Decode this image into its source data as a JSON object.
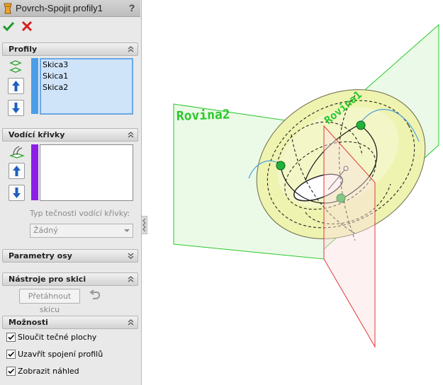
{
  "window": {
    "title": "Povrch-Spojit profily1",
    "help_label": "?"
  },
  "icons": {
    "title": "loft-feature-icon",
    "ok": "check-icon",
    "cancel": "x-icon",
    "help": "help-icon"
  },
  "sections": {
    "profiles": {
      "label": "Profily",
      "items": [
        "Skica3",
        "Skica1",
        "Skica2"
      ]
    },
    "guide_curves": {
      "label": "Vodící křivky",
      "items": [],
      "tangency_label": "Typ tečnosti vodící křivky:",
      "tangency_value": "Žádný"
    },
    "centerline": {
      "label": "Parametry osy"
    },
    "sketch_tools": {
      "label": "Nástroje pro skici",
      "drag_sketch_label": "Přetáhnout skicu"
    },
    "options": {
      "label": "Možnosti",
      "items": [
        {
          "label": "Sloučit tečné plochy",
          "checked": true
        },
        {
          "label": "Uzavřít spojení profilů",
          "checked": true
        },
        {
          "label": "Zobrazit náhled",
          "checked": true
        }
      ]
    }
  },
  "viewport": {
    "plane_label_1": "Rovina2",
    "plane_label_2": "Rovina1"
  },
  "colors": {
    "profiles_bar": "#4a9ee8",
    "guide_bar": "#8b1ee6",
    "plane_green": "#29c829",
    "plane_red": "#e23a3a",
    "surface": "#f3f6c4"
  }
}
